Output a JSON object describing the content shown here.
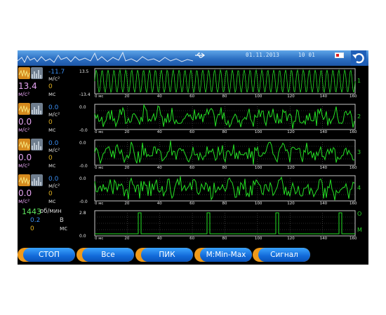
{
  "statusbar": {
    "date": "01.11.2013",
    "time": "10  01",
    "icons": [
      "usb-icon",
      "battery-icon",
      "back-arrow-icon"
    ]
  },
  "channels": [
    {
      "id": "1",
      "big_value": "13.4",
      "big_unit": "м/с²",
      "value1": "-11.7",
      "unit1": "м/с²",
      "value2": "0",
      "unit2": "мс",
      "y_max": "13.5",
      "y_min": "-13.4",
      "channel_label": "1"
    },
    {
      "id": "2",
      "big_value": "0.0",
      "big_unit": "м/с²",
      "value1": "0.0",
      "unit1": "м/с²",
      "value2": "0",
      "unit2": "мс",
      "y_max": "0.0",
      "y_min": "-0.0",
      "channel_label": "2"
    },
    {
      "id": "3",
      "big_value": "0.0",
      "big_unit": "м/с²",
      "value1": "0.0",
      "unit1": "м/с²",
      "value2": "0",
      "unit2": "мс",
      "y_max": "0.0",
      "y_min": "-0.0",
      "channel_label": "3"
    },
    {
      "id": "4",
      "big_value": "0.0",
      "big_unit": "м/с²",
      "value1": "0.0",
      "unit1": "м/с²",
      "value2": "0",
      "unit2": "мс",
      "y_max": "0.0",
      "y_min": "-0.0",
      "channel_label": "4"
    }
  ],
  "tacho": {
    "rpm_value": "1443",
    "rpm_unit": "об/мин",
    "volt_value": "0.2",
    "volt_unit": "В",
    "ms_value": "0",
    "ms_unit": "мс",
    "y_max": "2.8",
    "y_min": "0.0",
    "channel_label_top": "О",
    "channel_label_bottom": "М"
  },
  "time_axis": {
    "ticks": [
      "0",
      "20",
      "40",
      "60",
      "80",
      "100",
      "120",
      "140",
      "160"
    ],
    "unit": "мс"
  },
  "buttons": [
    {
      "label": "СТОП"
    },
    {
      "label": "Все"
    },
    {
      "label": "ПИК"
    },
    {
      "label": "M:Min-Max"
    },
    {
      "label": "Сигнал"
    }
  ],
  "colors": {
    "trace": "#24e024",
    "grid": "#5a5a5a",
    "button_face": "#1a74dc",
    "button_tab": "#ef9a1a",
    "statusbar": "#2c6fc2"
  }
}
